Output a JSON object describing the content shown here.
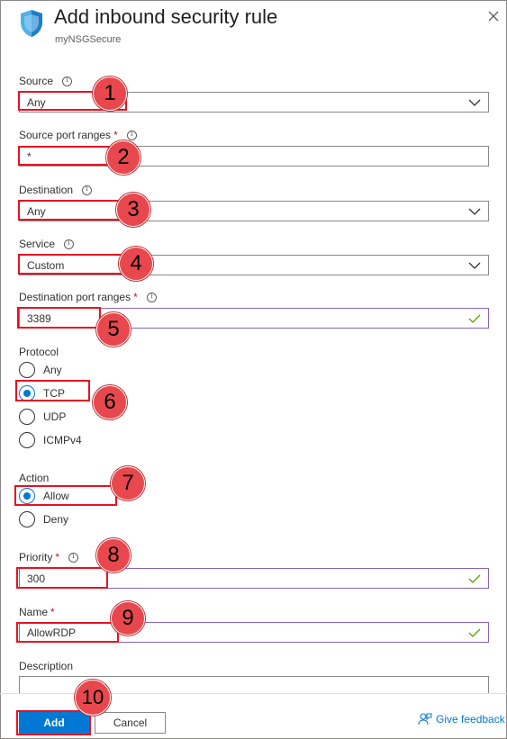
{
  "header": {
    "title": "Add inbound security rule",
    "subtitle": "myNSGSecure"
  },
  "form": {
    "source": {
      "label": "Source",
      "value": "Any"
    },
    "source_port_ranges": {
      "label": "Source port ranges",
      "required": "*",
      "value": "*"
    },
    "destination": {
      "label": "Destination",
      "value": "Any"
    },
    "service": {
      "label": "Service",
      "value": "Custom"
    },
    "destination_port_ranges": {
      "label": "Destination port ranges",
      "required": "*",
      "value": "3389"
    },
    "protocol": {
      "label": "Protocol",
      "options": [
        "Any",
        "TCP",
        "UDP",
        "ICMPv4"
      ],
      "selected": "TCP"
    },
    "action": {
      "label": "Action",
      "options": [
        "Allow",
        "Deny"
      ],
      "selected": "Allow"
    },
    "priority": {
      "label": "Priority",
      "required": "*",
      "value": "300"
    },
    "name": {
      "label": "Name",
      "required": "*",
      "value": "AllowRDP"
    },
    "description": {
      "label": "Description",
      "value": ""
    }
  },
  "footer": {
    "add_label": "Add",
    "cancel_label": "Cancel",
    "feedback_label": "Give feedback"
  },
  "annotations": [
    "1",
    "2",
    "3",
    "4",
    "5",
    "6",
    "7",
    "8",
    "9",
    "10"
  ],
  "colors": {
    "accent": "#0078d4",
    "annotation_red": "#e81123",
    "badge_fill": "#e8484d",
    "valid_border": "#8764b8",
    "valid_check": "#57a300",
    "required_star": "#a4262c"
  },
  "icons": {
    "header": "shield-icon",
    "close": "close-icon",
    "dropdown": "chevron-down-icon",
    "valid": "checkmark-icon",
    "info": "info-icon",
    "feedback": "feedback-icon"
  }
}
